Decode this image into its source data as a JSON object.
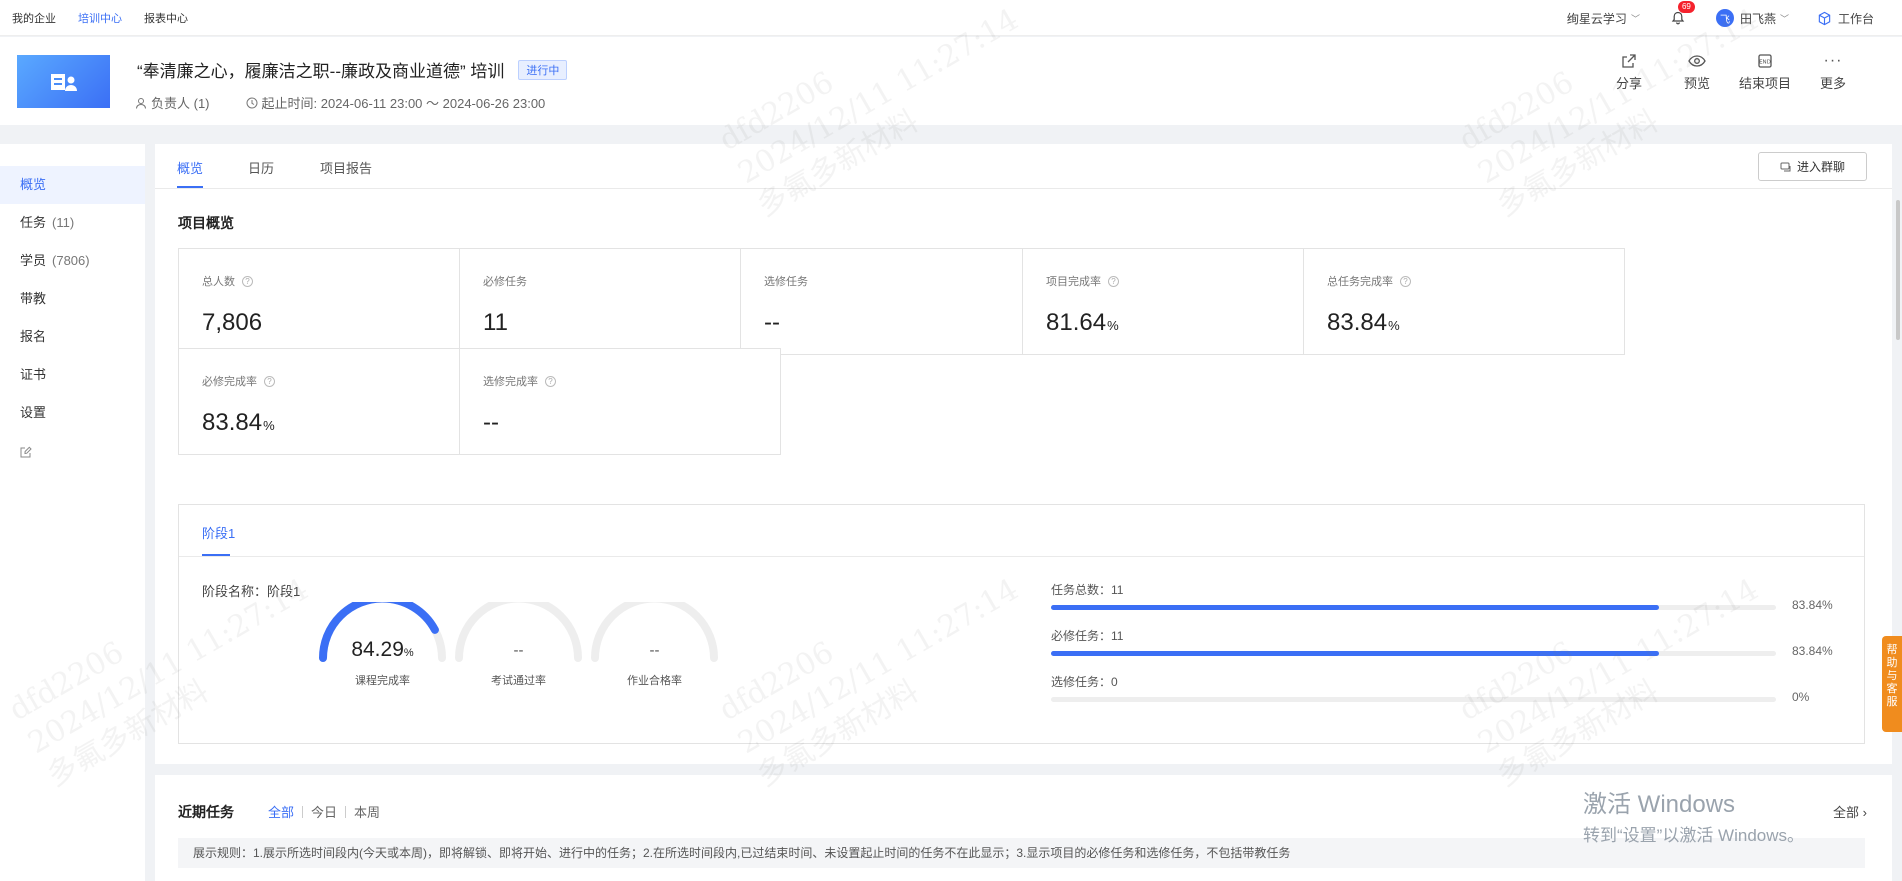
{
  "topnav": {
    "items": [
      "我的企业",
      "培训中心",
      "报表中心"
    ],
    "active_index": 1
  },
  "topright": {
    "org": "绚星云学习",
    "notification_count": "69",
    "user_avatar": "飞",
    "user_name": "田飞燕",
    "workbench": "工作台"
  },
  "project": {
    "title": "“奉清廉之心，履廉洁之职--廉政及商业道德”  培训",
    "status": "进行中",
    "owner": "负责人 (1)",
    "time_range": "起止时间: 2024-06-11 23:00 ～ 2024-06-26 23:00"
  },
  "header_actions": {
    "share": "分享",
    "preview": "预览",
    "end": "结束项目",
    "more": "更多"
  },
  "sidebar": {
    "items": [
      {
        "label": "概览",
        "count": ""
      },
      {
        "label": "任务",
        "count": "(11)"
      },
      {
        "label": "学员",
        "count": "(7806)"
      },
      {
        "label": "带教",
        "count": ""
      },
      {
        "label": "报名",
        "count": ""
      },
      {
        "label": "证书",
        "count": ""
      },
      {
        "label": "设置",
        "count": ""
      }
    ],
    "active_index": 0
  },
  "tabs": {
    "items": [
      "概览",
      "日历",
      "项目报告"
    ],
    "active_index": 0,
    "join_group": "进入群聊"
  },
  "overview": {
    "title": "项目概览",
    "cards": [
      {
        "label": "总人数",
        "value": "7,806",
        "unit": "",
        "help": true
      },
      {
        "label": "必修任务",
        "value": "11",
        "unit": "",
        "help": false
      },
      {
        "label": "选修任务",
        "value": "--",
        "unit": "",
        "help": false
      },
      {
        "label": "项目完成率",
        "value": "81.64",
        "unit": "%",
        "help": true
      },
      {
        "label": "总任务完成率",
        "value": "83.84",
        "unit": "%",
        "help": true
      },
      {
        "label": "必修完成率",
        "value": "83.84",
        "unit": "%",
        "help": true
      },
      {
        "label": "选修完成率",
        "value": "--",
        "unit": "",
        "help": true
      }
    ]
  },
  "stage": {
    "tab": "阶段1",
    "name": "阶段名称：阶段1",
    "gauges": [
      {
        "value": "84.29",
        "unit": "%",
        "label": "课程完成率",
        "fraction": 0.8429
      },
      {
        "value": "--",
        "unit": "",
        "label": "考试通过率",
        "fraction": 0
      },
      {
        "value": "--",
        "unit": "",
        "label": "作业合格率",
        "fraction": 0
      }
    ],
    "bars": [
      {
        "label": "任务总数：11",
        "percent_text": "83.84%",
        "fraction": 0.8384
      },
      {
        "label": "必修任务：11",
        "percent_text": "83.84%",
        "fraction": 0.8384
      },
      {
        "label": "选修任务：0",
        "percent_text": "0%",
        "fraction": 0
      }
    ]
  },
  "recent": {
    "title": "近期任务",
    "filters": [
      "全部",
      "今日",
      "本周"
    ],
    "active_filter": 0,
    "all_link": "全部 ›",
    "rule": "展示规则：1.展示所选时间段内(今天或本周)，即将解锁、即将开始、进行中的任务；2.在所选时间段内,已过结束时间、未设置起止时间的任务不在此显示；3.显示项目的必修任务和选修任务，不包括带教任务"
  },
  "help_float": "帮助与客服",
  "activation": {
    "line1": "激活 Windows",
    "line2": "转到“设置”以激活 Windows。"
  },
  "watermark": {
    "user": "dfd2206",
    "time": "2024/12/11 11:27:14",
    "org": "多氟多新材料"
  },
  "colors": {
    "primary": "#3b6ff5",
    "track": "#eeeeee",
    "help": "#f08c1e",
    "badge": "#f5222d"
  }
}
